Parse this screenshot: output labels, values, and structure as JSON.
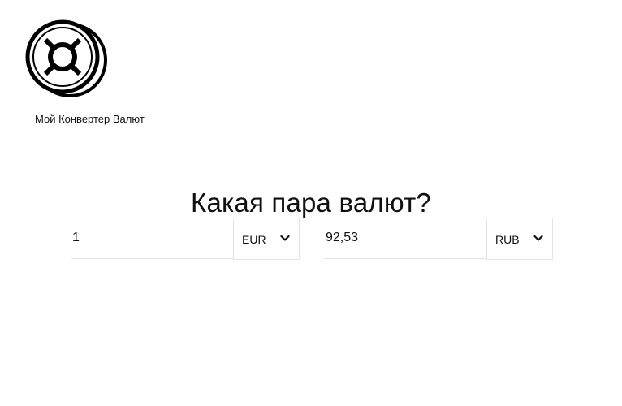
{
  "brand": {
    "logo_icon": "currency-sign-coin-icon",
    "name": "Мой Конвертер Валют"
  },
  "heading": "Какая пара валют?",
  "converter": {
    "from": {
      "amount": "1",
      "currency": "EUR",
      "dropdown_icon": "chevron-down-icon"
    },
    "to": {
      "amount": "92,53",
      "currency": "RUB",
      "dropdown_icon": "chevron-down-icon"
    }
  },
  "colors": {
    "text": "#111111",
    "border": "#e4e4e4",
    "background": "#ffffff"
  }
}
